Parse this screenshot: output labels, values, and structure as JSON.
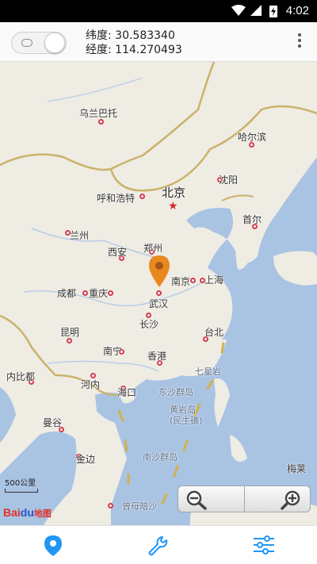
{
  "status_bar": {
    "time": "4:02"
  },
  "header": {
    "lat_line": "纬度: 30.583340",
    "lng_line": "经度: 114.270493"
  },
  "map": {
    "labels": {
      "wulanbatuo": "乌兰巴托",
      "haerbin": "哈尔滨",
      "shenyang": "沈阳",
      "huhehaote": "呼和浩特",
      "beijing": "北京",
      "lanzhou": "兰州",
      "xian": "西安",
      "zhengzhou": "郑州",
      "shouer": "首尔",
      "nanjing": "南京",
      "shanghai": "上海",
      "chengdu": "成都",
      "chongqing": "重庆",
      "wuhan": "武汉",
      "changsha": "长沙",
      "kunming": "昆明",
      "taibei": "台北",
      "nanning": "南宁",
      "xianggang": "香港",
      "qixingyan": "七星岩",
      "neibidu": "内比都",
      "henei": "河内",
      "haikou": "海口",
      "dongsha": "东沙群岛",
      "huangyan": "黄岩岛\n(民主礁)",
      "mangu": "曼谷",
      "jinbian": "金边",
      "nansha": "南沙群岛",
      "zengmu": "曾母暗沙",
      "meilai": "梅莱"
    },
    "scale": "500公里",
    "logo": {
      "bai": "Bai",
      "du": "du",
      "ditu": "地图"
    }
  },
  "colors": {
    "land": "#efece4",
    "sea": "#a9c3e3",
    "border": "#c9b36a",
    "accent": "#2196f3",
    "pin": "#e8891e"
  }
}
